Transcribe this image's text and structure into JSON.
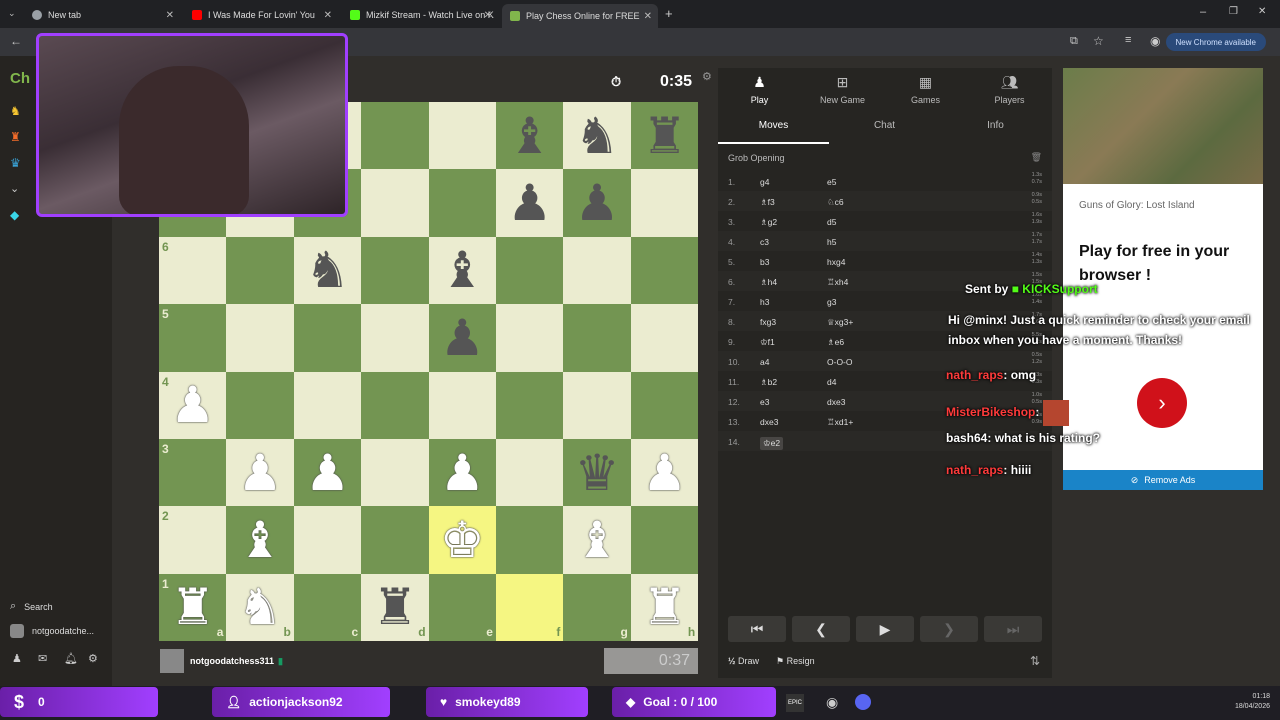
{
  "browser": {
    "tabs": [
      {
        "label": "New tab",
        "color": "#9aa0a6"
      },
      {
        "label": "I Was Made For Lovin' You",
        "color": "#ff0000"
      },
      {
        "label": "Mizkif Stream - Watch Live on K",
        "color": "#53fc18"
      },
      {
        "label": "Play Chess Online for FREE",
        "color": "#81b64c"
      }
    ],
    "new_chrome_label": "New Chrome available"
  },
  "left_nav": {
    "logo": "Ch",
    "search_label": "Search",
    "username": "notgoodatche..."
  },
  "game": {
    "top_clock": "0:35",
    "bottom_clock": "0:37",
    "bottom_player": "notgoodatchess311",
    "files": [
      "a",
      "b",
      "c",
      "d",
      "e",
      "f",
      "g",
      "h"
    ],
    "ranks": [
      "8",
      "7",
      "6",
      "5",
      "4",
      "3",
      "2",
      "1"
    ],
    "board": [
      [
        "",
        "",
        "",
        "",
        "",
        "bB",
        "bN",
        "bR"
      ],
      [
        "",
        "",
        "",
        "",
        "",
        "bP",
        "bP",
        ""
      ],
      [
        "",
        "",
        "bN",
        "",
        "bB",
        "",
        "",
        ""
      ],
      [
        "",
        "",
        "",
        "",
        "bP",
        "",
        "",
        ""
      ],
      [
        "wP",
        "",
        "",
        "",
        "",
        "",
        "",
        ""
      ],
      [
        "",
        "wP",
        "wP",
        "",
        "wP",
        "",
        "bQ",
        "wP"
      ],
      [
        "",
        "wB",
        "",
        "",
        "wK",
        "",
        "wB",
        ""
      ],
      [
        "wR",
        "wN",
        "",
        "bR",
        "",
        "",
        "",
        "wR"
      ]
    ],
    "highlight": [
      "e2",
      "f1"
    ]
  },
  "panel": {
    "tabs": [
      {
        "label": "Play",
        "icon": "pawn-icon"
      },
      {
        "label": "New Game",
        "icon": "plus-icon"
      },
      {
        "label": "Games",
        "icon": "board-icon"
      },
      {
        "label": "Players",
        "icon": "people-icon"
      }
    ],
    "subtabs": [
      "Moves",
      "Chat",
      "Info"
    ],
    "opening": "Grob Opening",
    "moves": [
      {
        "n": "1.",
        "w": "g4",
        "b": "e5",
        "t1": "1.3s",
        "t2": "0.7s"
      },
      {
        "n": "2.",
        "w": "♗f3",
        "b": "♘c6",
        "t1": "0.9s",
        "t2": "0.5s"
      },
      {
        "n": "3.",
        "w": "♗g2",
        "b": "d5",
        "t1": "1.6s",
        "t2": "1.9s"
      },
      {
        "n": "4.",
        "w": "c3",
        "b": "h5",
        "t1": "1.7s",
        "t2": "1.7s"
      },
      {
        "n": "5.",
        "w": "b3",
        "b": "hxg4",
        "t1": "1.4s",
        "t2": "1.3s"
      },
      {
        "n": "6.",
        "w": "♗h4",
        "b": "♖xh4",
        "t1": "1.5s",
        "t2": "1.5s"
      },
      {
        "n": "7.",
        "w": "h3",
        "b": "g3",
        "t1": "1.6s",
        "t2": "1.4s"
      },
      {
        "n": "8.",
        "w": "fxg3",
        "b": "♕xg3+",
        "t1": "1.7s",
        "t2": "1.6s"
      },
      {
        "n": "9.",
        "w": "♔f1",
        "b": "♗e6",
        "t1": "5.5s",
        "t2": "1.2s"
      },
      {
        "n": "10.",
        "w": "a4",
        "b": "O-O-O",
        "t1": "0.5s",
        "t2": "1.2s"
      },
      {
        "n": "11.",
        "w": "♗b2",
        "b": "d4",
        "t1": "1.3s",
        "t2": "0.3s"
      },
      {
        "n": "12.",
        "w": "e3",
        "b": "dxe3",
        "t1": "1.0s",
        "t2": "0.5s"
      },
      {
        "n": "13.",
        "w": "dxe3",
        "b": "♖xd1+",
        "t1": "1.2s",
        "t2": "0.9s"
      },
      {
        "n": "14.",
        "w": "♔e2",
        "b": "",
        "t1": "",
        "t2": ""
      }
    ],
    "draw_label": "Draw",
    "resign_label": "Resign"
  },
  "ad": {
    "title": "Guns of Glory: Lost Island",
    "headline": "Play for free in your browser !",
    "remove_label": "Remove Ads"
  },
  "chat": {
    "sent_by_prefix": "Sent by",
    "sent_by_user": "KICKSupport",
    "reminder": "Hi @minx! Just a quick reminder to check your email inbox when you have a moment. Thanks!",
    "messages": [
      {
        "user": "nath_raps",
        "text": "omg"
      },
      {
        "user": "MisterBikeshop",
        "text": ""
      },
      {
        "user": "bash64",
        "text": "what is his rating?"
      },
      {
        "user": "nath_raps",
        "text": "hiiii"
      }
    ]
  },
  "taskbar": {
    "coins": "0",
    "follower": "actionjackson92",
    "sub": "smokeyd89",
    "goal": "Goal : 0 / 100",
    "time": "01:18",
    "date": "18/04/2026"
  }
}
